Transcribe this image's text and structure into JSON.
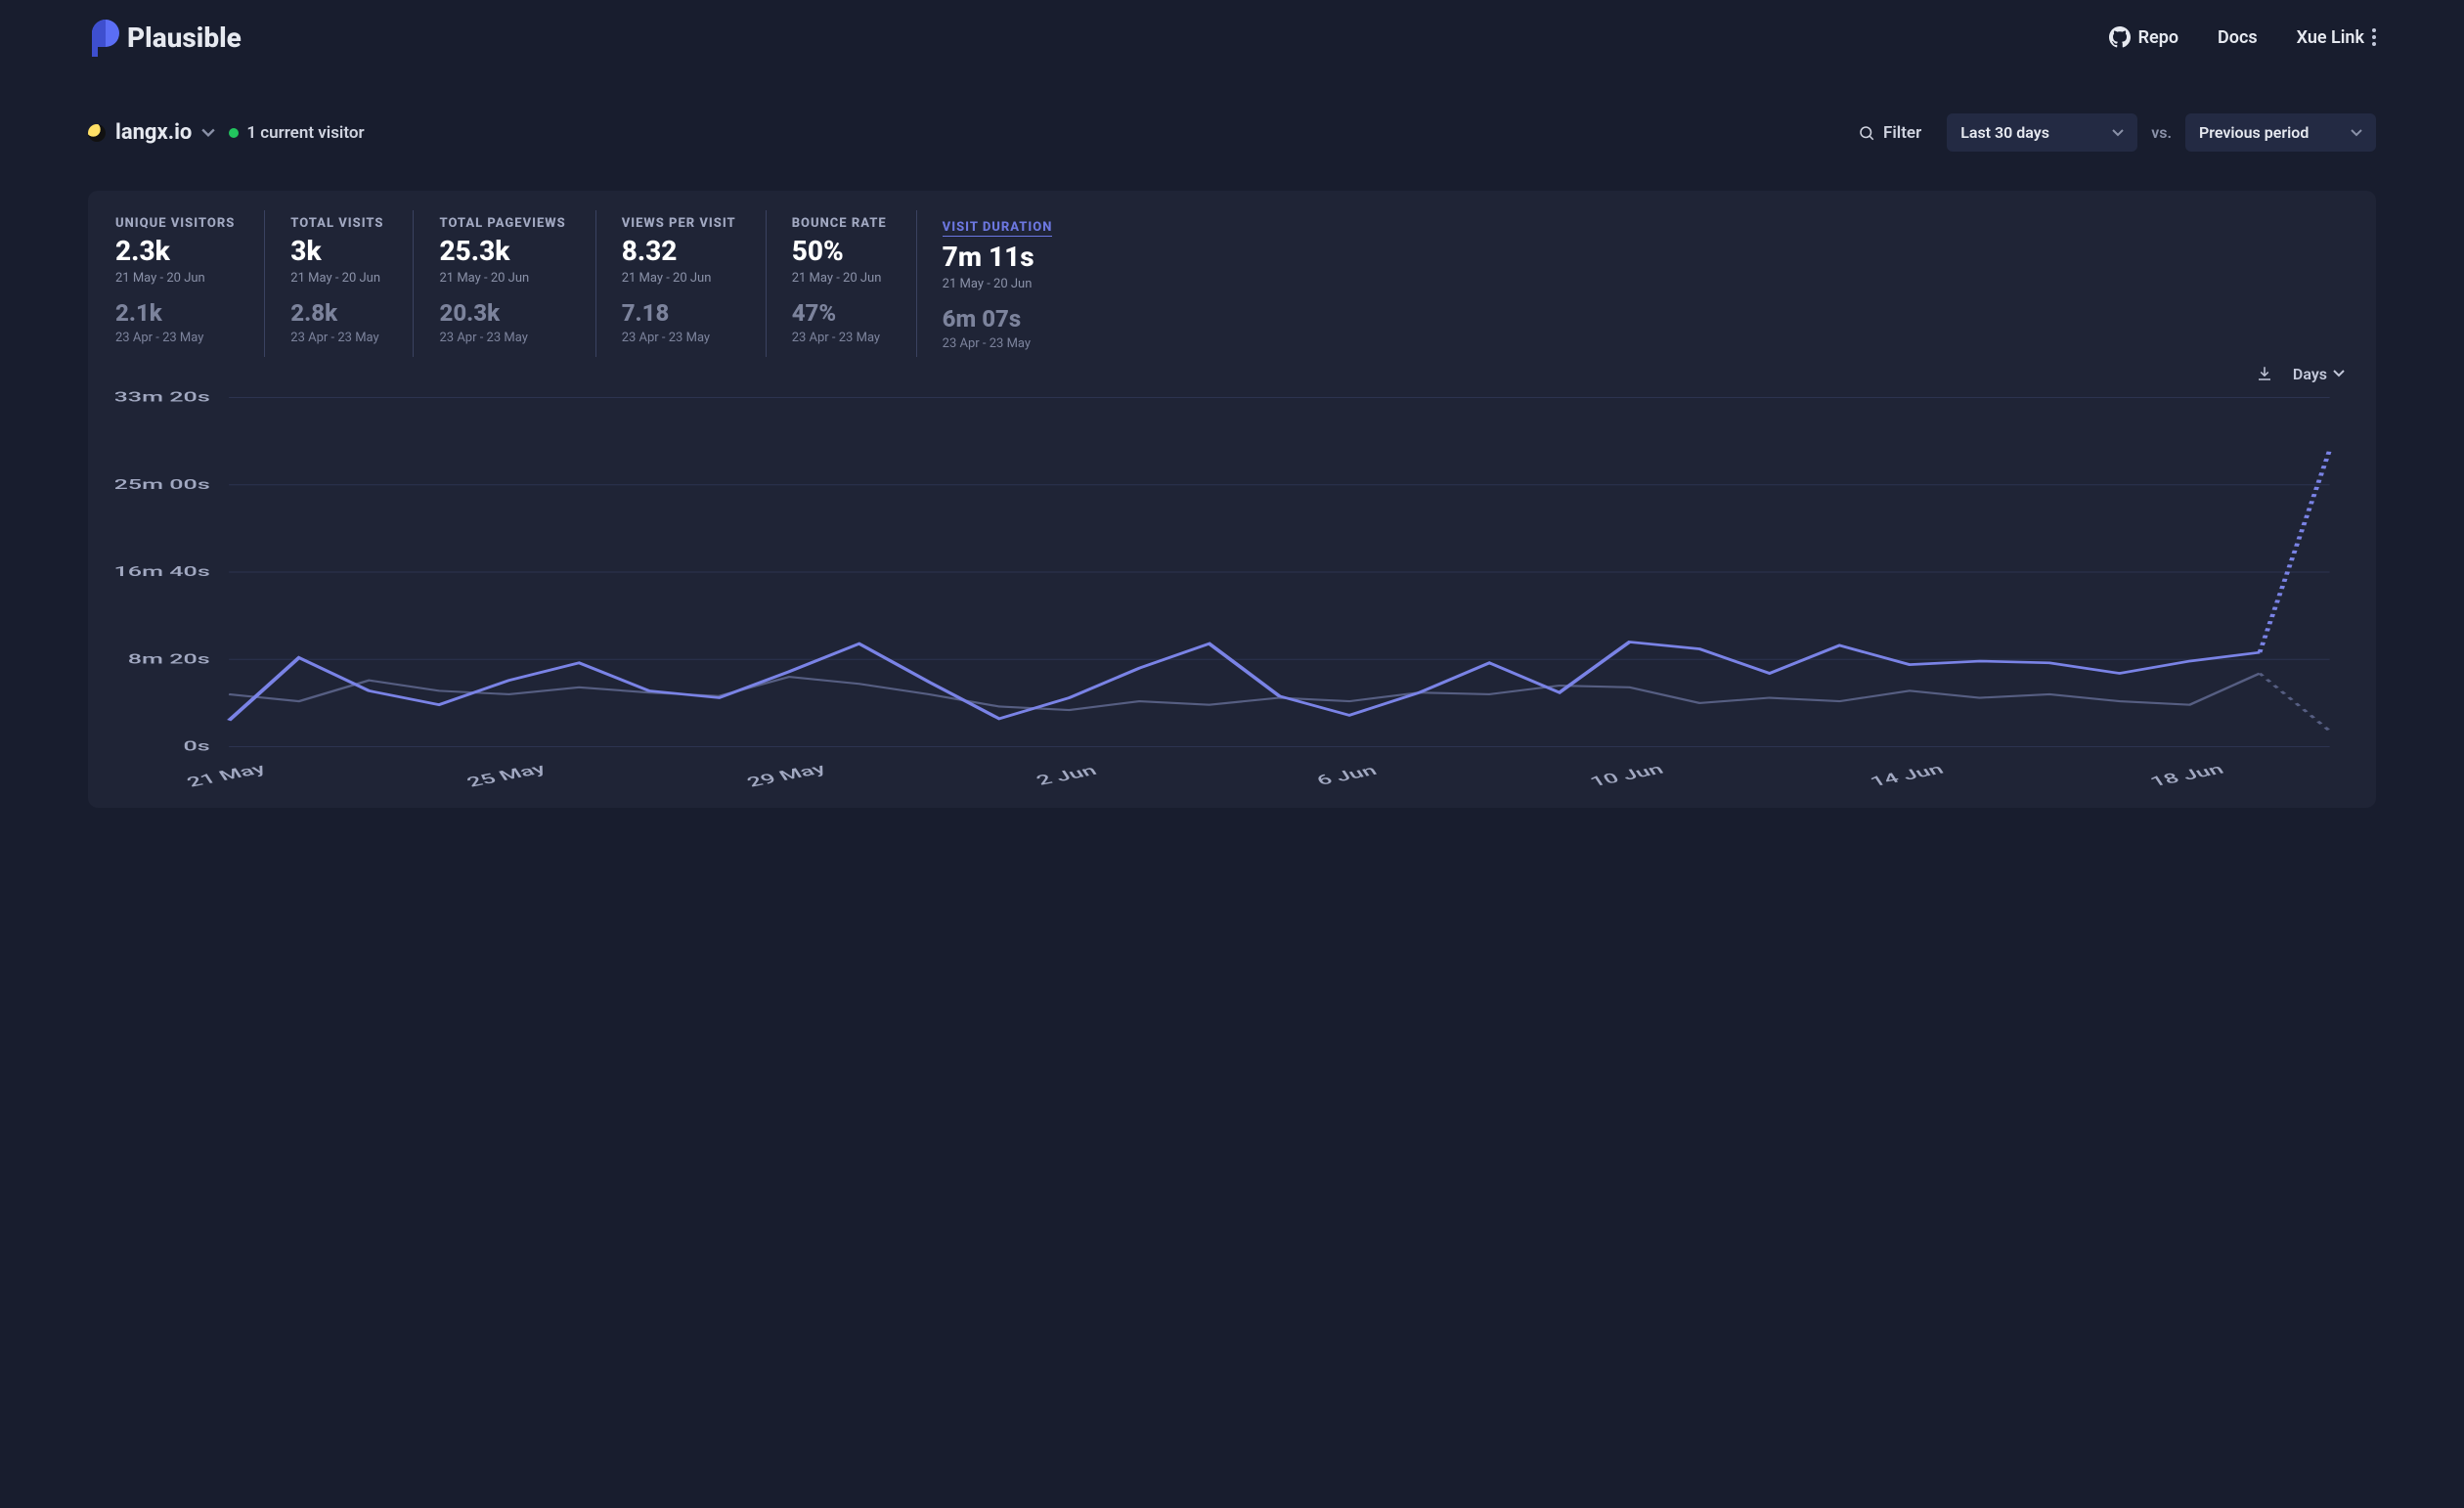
{
  "brand": "Plausible",
  "nav": {
    "repo": "Repo",
    "docs": "Docs",
    "user": "Xue Link"
  },
  "site": {
    "domain": "langx.io",
    "live_text": "1 current visitor",
    "filter_label": "Filter",
    "period": "Last 30 days",
    "vs": "vs.",
    "compare": "Previous period"
  },
  "stats": [
    {
      "label": "Unique visitors",
      "value": "2.3k",
      "date": "21 May - 20 Jun",
      "prev": "2.1k",
      "prev_date": "23 Apr - 23 May",
      "active": false
    },
    {
      "label": "Total visits",
      "value": "3k",
      "date": "21 May - 20 Jun",
      "prev": "2.8k",
      "prev_date": "23 Apr - 23 May",
      "active": false
    },
    {
      "label": "Total pageviews",
      "value": "25.3k",
      "date": "21 May - 20 Jun",
      "prev": "20.3k",
      "prev_date": "23 Apr - 23 May",
      "active": false
    },
    {
      "label": "Views per visit",
      "value": "8.32",
      "date": "21 May - 20 Jun",
      "prev": "7.18",
      "prev_date": "23 Apr - 23 May",
      "active": false
    },
    {
      "label": "Bounce rate",
      "value": "50%",
      "date": "21 May - 20 Jun",
      "prev": "47%",
      "prev_date": "23 Apr - 23 May",
      "active": false
    },
    {
      "label": "Visit duration",
      "value": "7m 11s",
      "date": "21 May - 20 Jun",
      "prev": "6m 07s",
      "prev_date": "23 Apr - 23 May",
      "active": true
    }
  ],
  "chart_tools": {
    "interval": "Days"
  },
  "chart_data": {
    "type": "line",
    "title": "",
    "xlabel": "",
    "ylabel": "Visit duration",
    "ylim_seconds": [
      0,
      2000
    ],
    "y_ticks": [
      "0s",
      "8m 20s",
      "16m 40s",
      "25m 00s",
      "33m 20s"
    ],
    "categories": [
      "21 May",
      "22 May",
      "23 May",
      "24 May",
      "25 May",
      "26 May",
      "27 May",
      "28 May",
      "29 May",
      "30 May",
      "31 May",
      "1 Jun",
      "2 Jun",
      "3 Jun",
      "4 Jun",
      "5 Jun",
      "6 Jun",
      "7 Jun",
      "8 Jun",
      "9 Jun",
      "10 Jun",
      "11 Jun",
      "12 Jun",
      "13 Jun",
      "14 Jun",
      "15 Jun",
      "16 Jun",
      "17 Jun",
      "18 Jun",
      "19 Jun",
      "20 Jun"
    ],
    "x_tick_labels": [
      "21 May",
      "25 May",
      "29 May",
      "2 Jun",
      "6 Jun",
      "10 Jun",
      "14 Jun",
      "18 Jun"
    ],
    "series": [
      {
        "name": "21 May - 20 Jun",
        "values_seconds": [
          150,
          510,
          320,
          240,
          380,
          480,
          320,
          280,
          430,
          590,
          370,
          160,
          280,
          450,
          590,
          290,
          180,
          310,
          480,
          310,
          600,
          560,
          420,
          580,
          470,
          490,
          480,
          420,
          490,
          540,
          1700
        ],
        "last_point_partial": true
      },
      {
        "name": "23 Apr - 23 May",
        "values_seconds": [
          300,
          260,
          380,
          320,
          300,
          340,
          310,
          290,
          400,
          360,
          300,
          230,
          210,
          260,
          240,
          280,
          260,
          310,
          300,
          350,
          340,
          250,
          280,
          260,
          320,
          280,
          300,
          260,
          240,
          420,
          90
        ],
        "last_point_partial": true
      }
    ]
  }
}
